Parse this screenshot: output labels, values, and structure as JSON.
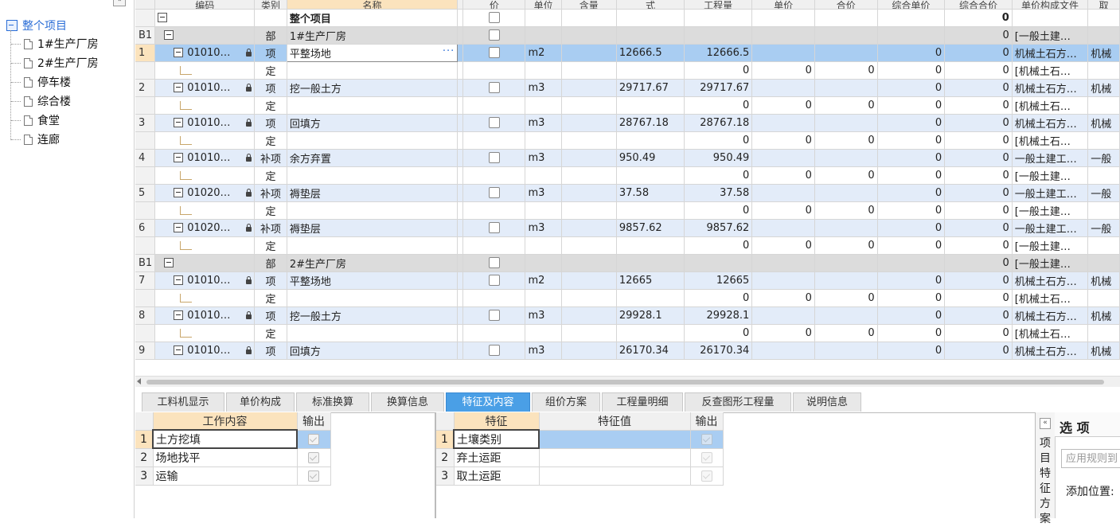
{
  "tree": {
    "collapse_glyph": "«",
    "root": "整个项目",
    "items": [
      "1#生产厂房",
      "2#生产厂房",
      "停车楼",
      "综合楼",
      "食堂",
      "连廊"
    ]
  },
  "grid": {
    "headers": [
      "",
      "编码",
      "类别",
      "名称",
      "",
      "价",
      "单位",
      "含量",
      "式",
      "工程量",
      "单价",
      "合价",
      "综合单价",
      "综合合价",
      "单价构成文件",
      "取"
    ],
    "rows": [
      {
        "rn": "",
        "code": "",
        "cat": "",
        "name": "整个项目",
        "total": "0",
        "ucf": "",
        "qu": "",
        "kind": "top"
      },
      {
        "rn": "B1",
        "code": "",
        "cat": "部",
        "name": "1#生产厂房",
        "total": "0",
        "ucf": "[一般土建…",
        "qu": "",
        "kind": "grp"
      },
      {
        "rn": "1",
        "code": "01010…",
        "cat": "项",
        "name": "平整场地",
        "unit": "m2",
        "expr": "12666.5",
        "qty": "12666.5",
        "zhdj": "0",
        "total": "0",
        "ucf": "机械土石方…",
        "qu": "机械",
        "kind": "selrow"
      },
      {
        "rn": "",
        "cat": "定",
        "qty": "0",
        "price": "0",
        "amount": "0",
        "zhdj": "0",
        "total": "0",
        "ucf": "[机械土石…",
        "kind": "ding"
      },
      {
        "rn": "2",
        "code": "01010…",
        "cat": "项",
        "name": "挖一般土方",
        "unit": "m3",
        "expr": "29717.67",
        "qty": "29717.67",
        "zhdj": "0",
        "total": "0",
        "ucf": "机械土石方…",
        "qu": "机械",
        "kind": "xiang"
      },
      {
        "rn": "",
        "cat": "定",
        "qty": "0",
        "price": "0",
        "amount": "0",
        "zhdj": "0",
        "total": "0",
        "ucf": "[机械土石…",
        "kind": "ding"
      },
      {
        "rn": "3",
        "code": "01010…",
        "cat": "项",
        "name": "回填方",
        "unit": "m3",
        "expr": "28767.18",
        "qty": "28767.18",
        "zhdj": "0",
        "total": "0",
        "ucf": "机械土石方…",
        "qu": "机械",
        "kind": "xiang"
      },
      {
        "rn": "",
        "cat": "定",
        "qty": "0",
        "price": "0",
        "amount": "0",
        "zhdj": "0",
        "total": "0",
        "ucf": "[机械土石…",
        "kind": "ding"
      },
      {
        "rn": "4",
        "code": "01010…",
        "cat": "补项",
        "name": "余方弃置",
        "unit": "m3",
        "expr": "950.49",
        "qty": "950.49",
        "zhdj": "0",
        "total": "0",
        "ucf": "一般土建工…",
        "qu": "一般",
        "kind": "xiang"
      },
      {
        "rn": "",
        "cat": "定",
        "qty": "0",
        "price": "0",
        "amount": "0",
        "zhdj": "0",
        "total": "0",
        "ucf": "[一般土建…",
        "kind": "ding"
      },
      {
        "rn": "5",
        "code": "01020…",
        "cat": "补项",
        "name": "褥垫层",
        "unit": "m3",
        "expr": "37.58",
        "qty": "37.58",
        "zhdj": "0",
        "total": "0",
        "ucf": "一般土建工…",
        "qu": "一般",
        "kind": "xiang"
      },
      {
        "rn": "",
        "cat": "定",
        "qty": "0",
        "price": "0",
        "amount": "0",
        "zhdj": "0",
        "total": "0",
        "ucf": "[一般土建…",
        "kind": "ding"
      },
      {
        "rn": "6",
        "code": "01020…",
        "cat": "补项",
        "name": "褥垫层",
        "unit": "m3",
        "expr": "9857.62",
        "qty": "9857.62",
        "zhdj": "0",
        "total": "0",
        "ucf": "一般土建工…",
        "qu": "一般",
        "kind": "xiang"
      },
      {
        "rn": "",
        "cat": "定",
        "qty": "0",
        "price": "0",
        "amount": "0",
        "zhdj": "0",
        "total": "0",
        "ucf": "[一般土建…",
        "kind": "ding"
      },
      {
        "rn": "B1",
        "code": "",
        "cat": "部",
        "name": "2#生产厂房",
        "total": "0",
        "ucf": "[一般土建…",
        "qu": "",
        "kind": "grp"
      },
      {
        "rn": "7",
        "code": "01010…",
        "cat": "项",
        "name": "平整场地",
        "unit": "m2",
        "expr": "12665",
        "qty": "12665",
        "zhdj": "0",
        "total": "0",
        "ucf": "机械土石方…",
        "qu": "机械",
        "kind": "xiang"
      },
      {
        "rn": "",
        "cat": "定",
        "qty": "0",
        "price": "0",
        "amount": "0",
        "zhdj": "0",
        "total": "0",
        "ucf": "[机械土石…",
        "kind": "ding"
      },
      {
        "rn": "8",
        "code": "01010…",
        "cat": "项",
        "name": "挖一般土方",
        "unit": "m3",
        "expr": "29928.1",
        "qty": "29928.1",
        "zhdj": "0",
        "total": "0",
        "ucf": "机械土石方…",
        "qu": "机械",
        "kind": "xiang"
      },
      {
        "rn": "",
        "cat": "定",
        "qty": "0",
        "price": "0",
        "amount": "0",
        "zhdj": "0",
        "total": "0",
        "ucf": "[机械土石…",
        "kind": "ding"
      },
      {
        "rn": "9",
        "code": "01010…",
        "cat": "项",
        "name": "回填方",
        "unit": "m3",
        "expr": "26170.34",
        "qty": "26170.34",
        "zhdj": "0",
        "total": "0",
        "ucf": "机械土石方…",
        "qu": "机械",
        "kind": "xiang"
      }
    ],
    "edit_more": "···"
  },
  "tabs": [
    "工料机显示",
    "单价构成",
    "标准换算",
    "换算信息",
    "特征及内容",
    "组价方案",
    "工程量明细",
    "反查图形工程量",
    "说明信息"
  ],
  "active_tab": 4,
  "work": {
    "headers": [
      "工作内容",
      "输出"
    ],
    "rows": [
      {
        "n": "1",
        "text": "土方挖填"
      },
      {
        "n": "2",
        "text": "场地找平"
      },
      {
        "n": "3",
        "text": "运输"
      }
    ]
  },
  "feature": {
    "headers": [
      "特征",
      "特征值",
      "输出"
    ],
    "rows": [
      {
        "n": "1",
        "text": "土壤类别",
        "value": ""
      },
      {
        "n": "2",
        "text": "弃土运距",
        "value": ""
      },
      {
        "n": "3",
        "text": "取土运距",
        "value": ""
      }
    ]
  },
  "options": {
    "collapse_glyph": "«",
    "title": "选 项",
    "vertical_label": "项目特征方案",
    "rule_placeholder": "应用规则到",
    "add_position_label": "添加位置:"
  },
  "colors": {
    "accent": "#4a9fe6",
    "selected_row": "#a9cdf2",
    "header_selected": "#fbe3bd",
    "link": "#2a6dd6"
  }
}
